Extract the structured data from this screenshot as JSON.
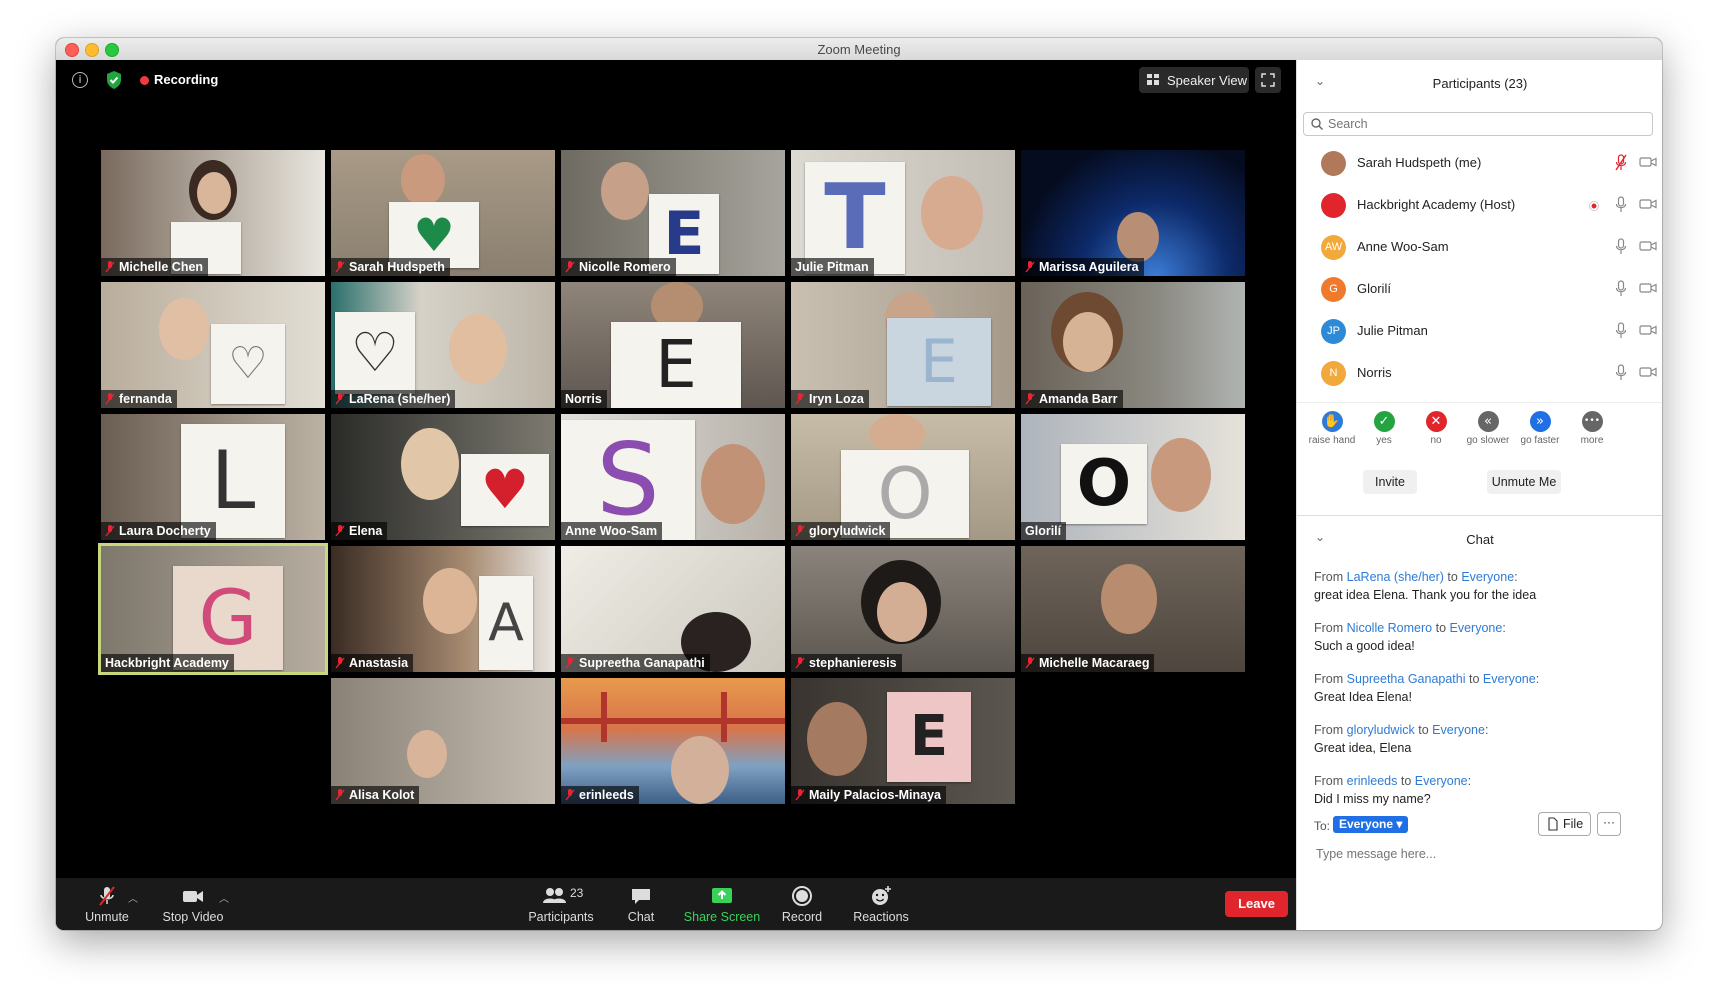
{
  "window": {
    "title": "Zoom Meeting"
  },
  "topbar": {
    "recording_label": "Recording",
    "speaker_view_label": "Speaker View"
  },
  "tiles": [
    {
      "name": "Michelle Chen"
    },
    {
      "name": "Sarah Hudspeth"
    },
    {
      "name": "Nicolle Romero"
    },
    {
      "name": "Julie Pitman"
    },
    {
      "name": "Marissa Aguilera"
    },
    {
      "name": "fernanda"
    },
    {
      "name": "LaRena (she/her)"
    },
    {
      "name": "Norris"
    },
    {
      "name": "Iryn Loza"
    },
    {
      "name": "Amanda Barr"
    },
    {
      "name": "Laura Docherty"
    },
    {
      "name": "Elena"
    },
    {
      "name": "Anne Woo-Sam"
    },
    {
      "name": "gloryludwick"
    },
    {
      "name": "Glorilí"
    },
    {
      "name": "Hackbright Academy"
    },
    {
      "name": "Anastasia"
    },
    {
      "name": "Supreetha Ganapathi"
    },
    {
      "name": "stephanieresis"
    },
    {
      "name": "Michelle Macaraeg"
    },
    {
      "name": "Alisa Kolot"
    },
    {
      "name": "erinleeds"
    },
    {
      "name": "Maily Palacios-Minaya"
    }
  ],
  "signs": {
    "e1": "E",
    "t": "T",
    "e2": "E",
    "e3": "E",
    "l": "L",
    "s": "S",
    "o": "O",
    "g": "G",
    "a": "A",
    "e4": "E"
  },
  "toolbar": {
    "unmute": "Unmute",
    "stop_video": "Stop Video",
    "participants": "Participants",
    "participants_count": "23",
    "chat": "Chat",
    "share_screen": "Share Screen",
    "record": "Record",
    "reactions": "Reactions",
    "leave": "Leave"
  },
  "participants_panel": {
    "title": "Participants (23)",
    "search_placeholder": "Search",
    "items": [
      {
        "name": "Sarah Hudspeth (me)",
        "initials": "",
        "color": "#b07a5a"
      },
      {
        "name": "Hackbright Academy (Host)",
        "initials": "",
        "color": "#e0262c"
      },
      {
        "name": "Anne Woo-Sam",
        "initials": "AW",
        "color": "#f2a93b"
      },
      {
        "name": "Glorilí",
        "initials": "G",
        "color": "#f07a2c"
      },
      {
        "name": "Julie Pitman",
        "initials": "JP",
        "color": "#2d8ad6"
      },
      {
        "name": "Norris",
        "initials": "N",
        "color": "#f2a93b"
      }
    ],
    "reactions": [
      {
        "label": "raise hand",
        "color": "#2d7bd6",
        "glyph": "✋"
      },
      {
        "label": "yes",
        "color": "#23a440",
        "glyph": "✓"
      },
      {
        "label": "no",
        "color": "#e0262c",
        "glyph": "✕"
      },
      {
        "label": "go slower",
        "color": "#666666",
        "glyph": "«"
      },
      {
        "label": "go faster",
        "color": "#1f6fe5",
        "glyph": "»"
      },
      {
        "label": "more",
        "color": "#666666",
        "glyph": "•••"
      }
    ],
    "invite": "Invite",
    "unmute_me": "Unmute Me"
  },
  "chat_panel": {
    "title": "Chat",
    "messages": [
      {
        "from": "From",
        "sender": "LaRena (she/her)",
        "to": "to",
        "recipient": "Everyone",
        "text": "great idea Elena. Thank you for the idea"
      },
      {
        "from": "From",
        "sender": "Nicolle Romero",
        "to": "to",
        "recipient": "Everyone",
        "text": "Such a good idea!"
      },
      {
        "from": "From",
        "sender": "Supreetha Ganapathi",
        "to": "to",
        "recipient": "Everyone",
        "text": "Great Idea Elena!"
      },
      {
        "from": "From",
        "sender": "gloryludwick",
        "to": "to",
        "recipient": "Everyone",
        "text": "Great idea, Elena"
      },
      {
        "from": "From",
        "sender": "erinleeds",
        "to": "to",
        "recipient": "Everyone",
        "text": "Did I miss my name?"
      }
    ],
    "to_label": "To:",
    "to_value": "Everyone",
    "file_label": "File",
    "more_label": "···",
    "input_placeholder": "Type message here..."
  }
}
